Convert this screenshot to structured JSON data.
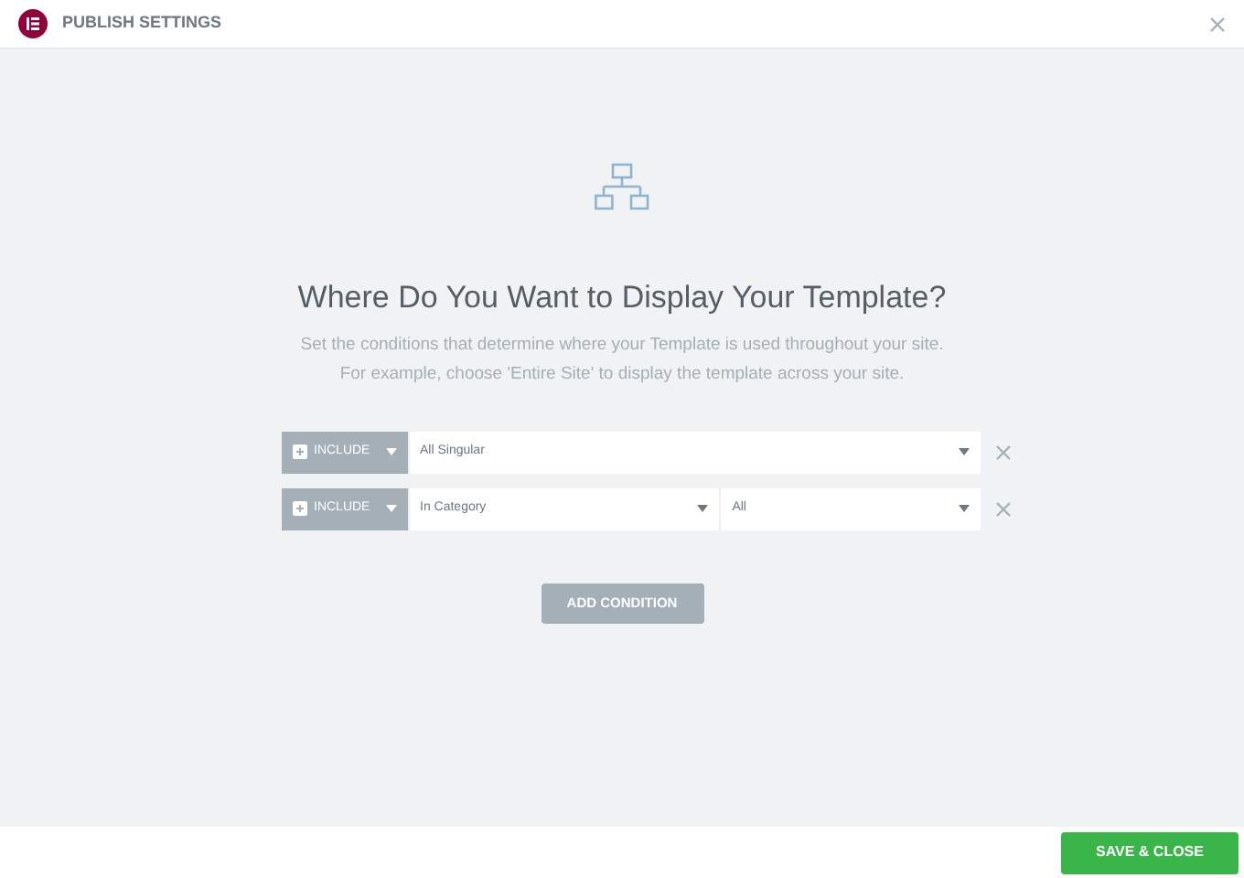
{
  "window": {
    "title": "PUBLISH SETTINGS"
  },
  "heading": "Where Do You Want to Display Your Template?",
  "description": [
    "Set the conditions that determine where your Template is used throughout your site.",
    "For example, choose 'Entire Site' to display the template across your site."
  ],
  "conditions": [
    {
      "type": "INCLUDE",
      "selects": [
        "All Singular"
      ]
    },
    {
      "type": "INCLUDE",
      "selects": [
        "In Category",
        "All"
      ]
    }
  ],
  "add_button": "ADD CONDITION",
  "save_button": "SAVE & CLOSE"
}
